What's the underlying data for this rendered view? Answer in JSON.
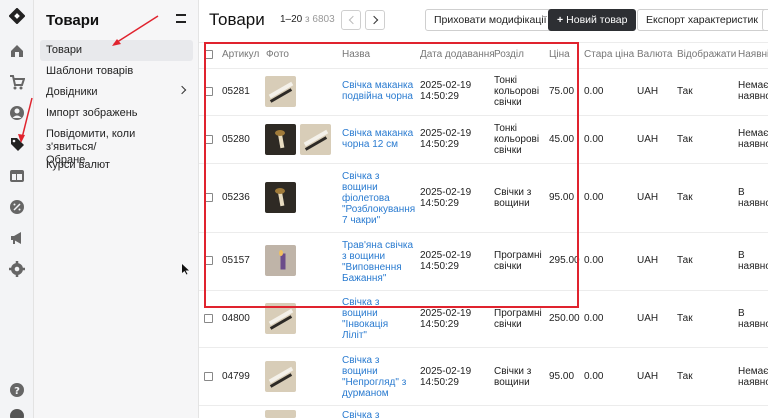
{
  "sidebar": {
    "title": "Товари",
    "items": [
      {
        "label": "Товари",
        "active": true
      },
      {
        "label": "Шаблони товарів"
      },
      {
        "label": "Довідники",
        "has_children": true
      },
      {
        "label": "Імпорт зображень"
      },
      {
        "label": "Повідомити, коли з'явиться/\nОбране"
      },
      {
        "label": "Курси валют"
      }
    ]
  },
  "header": {
    "title": "Товари",
    "range": "1–20",
    "range_of": "з 6803",
    "hide_mods_label": "Приховати модифікації",
    "new_product_label": "Новий товар",
    "export_label": "Експорт характеристик"
  },
  "table": {
    "columns": [
      "Артикул",
      "Фото",
      "Назва",
      "Дата додавання",
      "Розділ",
      "Ціна",
      "Стара ціна",
      "Валюта",
      "Відображати",
      "Наявні"
    ],
    "rows": [
      {
        "sku": "05281",
        "name": "Свічка маканка\nподвійна чорна",
        "date": "2025-02-19\n14:50:29",
        "section": "Тонкі\nкольорові\nсвічки",
        "price": "75.00",
        "old_price": "0.00",
        "currency": "UAH",
        "show": "Так",
        "stock": "Немає\nнаявно"
      },
      {
        "sku": "05280",
        "name": "Свічка маканка\nчорна 12 см",
        "date": "2025-02-19\n14:50:29",
        "section": "Тонкі\nкольорові\nсвічки",
        "price": "45.00",
        "old_price": "0.00",
        "currency": "UAH",
        "show": "Так",
        "stock": "Немає\nнаявно"
      },
      {
        "sku": "05236",
        "name": "Свічка з\nвощини\nфіолетова\n\"Розблокування\n7 чакри\"",
        "date": "2025-02-19\n14:50:29",
        "section": "Свічки з\nвощини",
        "price": "95.00",
        "old_price": "0.00",
        "currency": "UAH",
        "show": "Так",
        "stock": "В\nнаявно"
      },
      {
        "sku": "05157",
        "name": "Трав'яна свічка\nз вощини\n\"Виповнення\nБажання\"",
        "date": "2025-02-19\n14:50:29",
        "section": "Програмні\nсвічки",
        "price": "295.00",
        "old_price": "0.00",
        "currency": "UAH",
        "show": "Так",
        "stock": "В\nнаявно"
      },
      {
        "sku": "04800",
        "name": "Свічка з\nвощини\n\"Інвокація\nЛіліт\"",
        "date": "2025-02-19\n14:50:29",
        "section": "Програмні\nсвічки",
        "price": "250.00",
        "old_price": "0.00",
        "currency": "UAH",
        "show": "Так",
        "stock": "В\nнаявно"
      },
      {
        "sku": "04799",
        "name": "Свічка з\nвощини\n\"Непрогляд\" з\nдурманом",
        "date": "2025-02-19\n14:50:29",
        "section": "Свічки з\nвощини",
        "price": "95.00",
        "old_price": "0.00",
        "currency": "UAH",
        "show": "Так",
        "stock": "Немає\nнаявно"
      },
      {
        "name": "Свічка з"
      }
    ]
  },
  "colors": {
    "accent": "#2a7bd0",
    "highlight": "#e0232e",
    "primary_button": "#2d2f33"
  }
}
